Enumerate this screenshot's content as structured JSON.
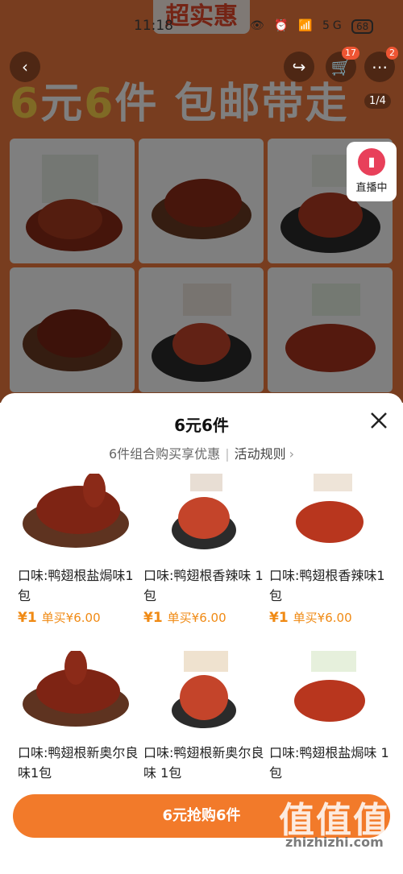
{
  "status_bar": {
    "time": "11:18",
    "icons": "👁 ⏰ 📶 5G",
    "battery": "68"
  },
  "background": {
    "banner_tag": "超实惠",
    "banner_title_a": "6",
    "banner_title_b": "元",
    "banner_title_c": "6",
    "banner_title_d": "件 包邮带走",
    "cart_badge": "17",
    "more_badge": "2",
    "pager": "1/4",
    "live_label": "直播中"
  },
  "sheet": {
    "title": "6元6件",
    "subtitle": "6件组合购买享优惠",
    "rules_label": "活动规则",
    "items": [
      {
        "name": "口味:鸭翅根盐焗味1包",
        "price": "¥1",
        "orig": "单买¥6.00"
      },
      {
        "name": "口味:鸭翅根香辣味 1包",
        "price": "¥1",
        "orig": "单买¥6.00"
      },
      {
        "name": "口味:鸭翅根香辣味1包",
        "price": "¥1",
        "orig": "单买¥6.00"
      },
      {
        "name": "口味:鸭翅根新奥尔良味1包",
        "price": "",
        "orig": ""
      },
      {
        "name": "口味:鸭翅根新奥尔良味 1包",
        "price": "",
        "orig": ""
      },
      {
        "name": "口味:鸭翅根盐焗味 1包",
        "price": "",
        "orig": ""
      }
    ],
    "buy_label": "6元抢购6件"
  },
  "watermark": {
    "brand": "值值值",
    "url": "zhizhizhi.com"
  }
}
